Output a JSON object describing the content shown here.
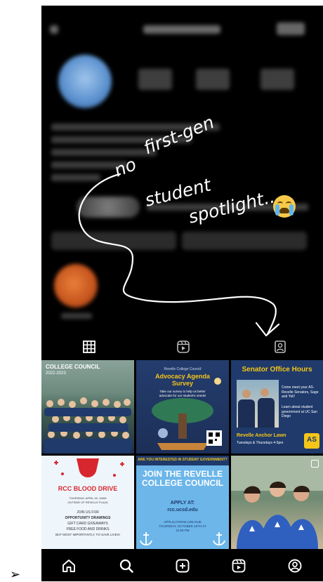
{
  "annotation": {
    "line1": "no",
    "line2": "first-gen",
    "line3": "student",
    "line4": "spotlight...",
    "emoji": "loudly-crying-face"
  },
  "profile_tabs": [
    {
      "name": "grid-icon"
    },
    {
      "name": "reels-icon"
    },
    {
      "name": "tagged-icon"
    }
  ],
  "posts": [
    {
      "header": "COLLEGE COUNCIL",
      "caption": "2022-2023"
    },
    {
      "header": "Revelle College Council",
      "title": "Advocacy Agenda Survey",
      "subtitle": "Take our survey to help us better advocate for our student's needs!"
    },
    {
      "title": "Senator Office Hours",
      "body1": "Come meet your AS-Revelle Senators, Sage and Yoli!",
      "body2": "Learn about student government at UC San Diego",
      "footer": "Revelle Anchor Lawn",
      "footer2": "Tuesdays & Thursdays 4-5pm",
      "badge": "AS"
    },
    {
      "title": "RCC BLOOD DRIVE",
      "line1": "THURSDAY, APRIL 18, 10AM",
      "line2": "OUTSIDE OF REVELLE PLAZA",
      "line3": "JOIN US FOR",
      "line4": "OPPORTUNITY DRAWINGS",
      "line5": "GIFT CARD GIVEAWAYS",
      "line6": "FREE FOOD AND DRINKS",
      "line7": "BUT MOST IMPORTANTLY, TO SAVE LIVES!"
    },
    {
      "header": "ARE YOU INTERESTED IN STUDENT GOVERNMENT?",
      "title": "JOIN THE REVELLE COLLEGE COUNCIL",
      "apply": "APPLY AT:",
      "url": "rcc.ucsd.edu",
      "note": "APPLICATIONS ARE DUE THURSDAY, OCTOBER 10TH AT 11:59 PM"
    },
    {
      "caption": ""
    }
  ],
  "nav": [
    {
      "name": "home-icon"
    },
    {
      "name": "search-icon"
    },
    {
      "name": "create-icon"
    },
    {
      "name": "reels-nav-icon"
    },
    {
      "name": "profile-icon"
    }
  ],
  "pointer_glyph": "➢",
  "colors": {
    "navy": "#1f3a6b",
    "gold": "#f5c518",
    "sky": "#6cb6ea",
    "red": "#d8262e"
  }
}
